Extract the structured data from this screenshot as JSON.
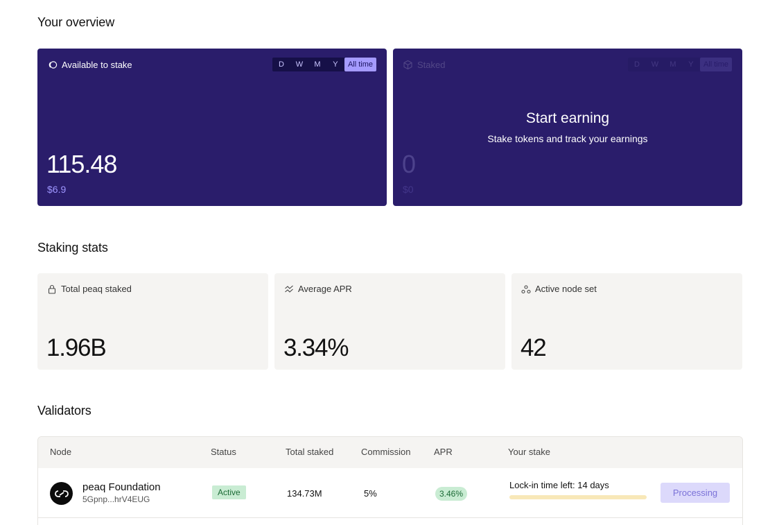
{
  "overview": {
    "title": "Your overview",
    "ranges": [
      "D",
      "W",
      "M",
      "Y",
      "All time"
    ],
    "available": {
      "label": "Available to stake",
      "icon": "coins-icon",
      "value": "115.48",
      "usd": "$6.9",
      "active_range": "All time"
    },
    "staked": {
      "label": "Staked",
      "icon": "cube-icon",
      "value": "0",
      "usd": "$0",
      "empty_title": "Start earning",
      "empty_subtitle": "Stake tokens and track your earnings"
    }
  },
  "stats": {
    "title": "Staking stats",
    "items": [
      {
        "label": "Total peaq staked",
        "icon": "lock-icon",
        "value": "1.96B"
      },
      {
        "label": "Average APR",
        "icon": "trend-icon",
        "value": "3.34%"
      },
      {
        "label": "Active node set",
        "icon": "nodes-icon",
        "value": "42"
      }
    ]
  },
  "validators": {
    "title": "Validators",
    "columns": [
      "Node",
      "Status",
      "Total staked",
      "Commission",
      "APR",
      "Your stake"
    ],
    "rows": [
      {
        "name": "peaq Foundation",
        "address": "5Gpnp...hrV4EUG",
        "status": "Active",
        "total_staked": "134.73M",
        "commission": "5%",
        "apr": "3.46%",
        "lock_text": "Lock-in time left: 14 days",
        "lock_progress": 0.0,
        "action": "Processing"
      }
    ]
  },
  "colors": {
    "card_bg": "#2a1d6b",
    "accent": "#a59bff",
    "success_bg": "#c9ecd3",
    "stat_bg": "#f5f4f2"
  }
}
